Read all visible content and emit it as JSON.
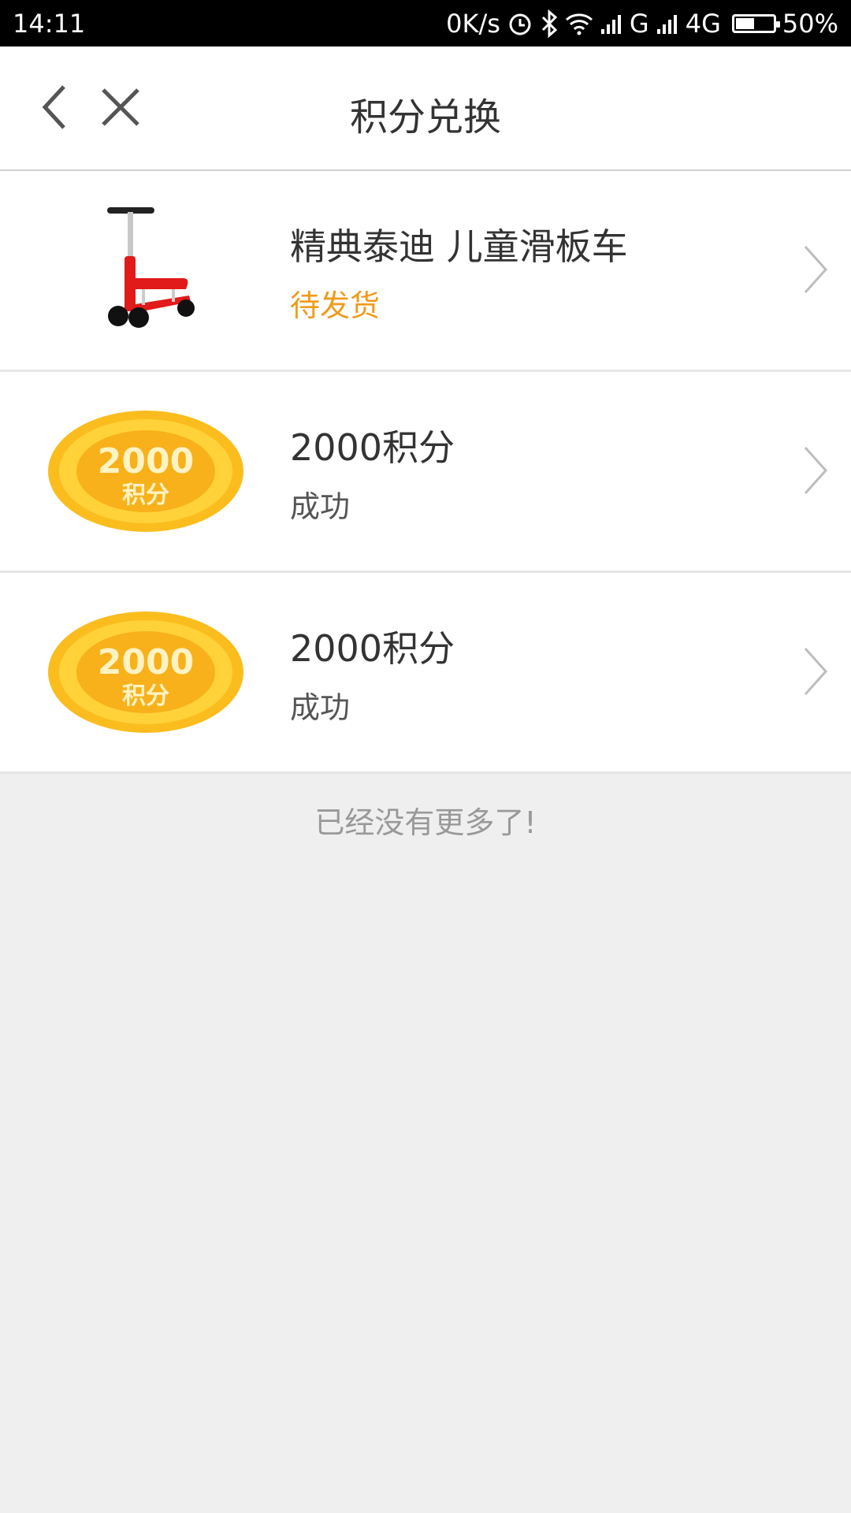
{
  "statusbar": {
    "time": "14:11",
    "net_speed": "0K/s",
    "network_g": "G",
    "network_4g": "4G",
    "battery_percent": "50%",
    "battery_level": 0.5,
    "icons": [
      "alarm-icon",
      "bluetooth-icon",
      "wifi-icon",
      "signal-icon",
      "signal-icon",
      "battery-icon"
    ]
  },
  "navbar": {
    "title": "积分兑换",
    "back_icon": "chevron-left-icon",
    "close_icon": "close-icon"
  },
  "items": [
    {
      "title": "精典泰迪 儿童滑板车",
      "status": "待发货",
      "status_color": "#f09a1a",
      "image": "scooter-image"
    },
    {
      "title": "2000积分",
      "status": "成功",
      "image": "points-coin-image",
      "coin_number": "2000",
      "coin_label": "积分"
    },
    {
      "title": "2000积分",
      "status": "成功",
      "image": "points-coin-image",
      "coin_number": "2000",
      "coin_label": "积分"
    }
  ],
  "footer": {
    "no_more_text": "已经没有更多了!"
  },
  "colors": {
    "accent_orange": "#f09a1a",
    "coin_gold": "#fbbd1e",
    "background": "#efefef"
  }
}
